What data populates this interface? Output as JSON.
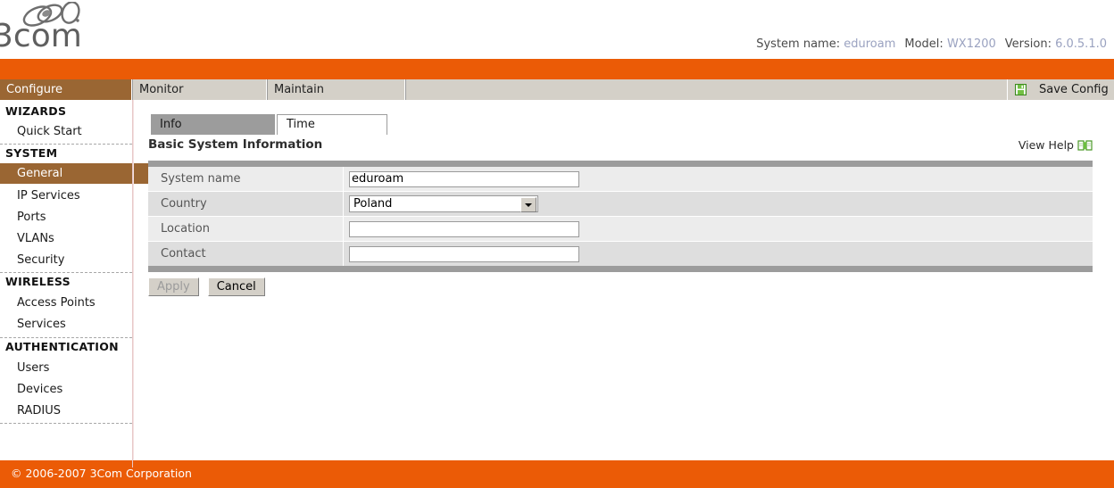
{
  "header": {
    "logo_alt": "3com",
    "system_info": [
      {
        "label": "System name:",
        "value": "eduroam"
      },
      {
        "label": "Model:",
        "value": "WX1200"
      },
      {
        "label": "Version:",
        "value": "6.0.5.1.0"
      }
    ]
  },
  "nav": {
    "tabs": [
      {
        "label": "Configure",
        "active": true
      },
      {
        "label": "Monitor",
        "active": false
      },
      {
        "label": "Maintain",
        "active": false
      }
    ],
    "save_config_label": "Save Config",
    "save_icon": "floppy-disk-icon"
  },
  "sidebar": {
    "groups": [
      {
        "title": "WIZARDS",
        "items": [
          {
            "label": "Quick Start",
            "selected": false
          }
        ]
      },
      {
        "title": "SYSTEM",
        "items": [
          {
            "label": "General",
            "selected": true
          },
          {
            "label": "IP Services",
            "selected": false
          },
          {
            "label": "Ports",
            "selected": false
          },
          {
            "label": "VLANs",
            "selected": false
          },
          {
            "label": "Security",
            "selected": false
          }
        ]
      },
      {
        "title": "WIRELESS",
        "items": [
          {
            "label": "Access Points",
            "selected": false
          },
          {
            "label": "Services",
            "selected": false
          }
        ]
      },
      {
        "title": "AUTHENTICATION",
        "items": [
          {
            "label": "Users",
            "selected": false
          },
          {
            "label": "Devices",
            "selected": false
          },
          {
            "label": "RADIUS",
            "selected": false
          }
        ]
      }
    ]
  },
  "content": {
    "tabs": [
      {
        "label": "Info",
        "active": true
      },
      {
        "label": "Time",
        "active": false
      }
    ],
    "section_title": "Basic System Information",
    "view_help_label": "View Help",
    "view_help_icon": "open-book-icon",
    "form_rows": [
      {
        "label": "System name",
        "type": "text",
        "value": "eduroam",
        "placeholder": ""
      },
      {
        "label": "Country",
        "type": "select",
        "value": "Poland"
      },
      {
        "label": "Location",
        "type": "text",
        "value": "",
        "placeholder": ""
      },
      {
        "label": "Contact",
        "type": "text",
        "value": "",
        "placeholder": ""
      }
    ],
    "buttons": [
      {
        "label": "Apply",
        "disabled": true
      },
      {
        "label": "Cancel",
        "disabled": false
      }
    ]
  },
  "footer": {
    "copyright": "© 2006-2007 3Com Corporation"
  },
  "colors": {
    "orange": "#eb5b06",
    "nav_gray": "#9c9c9c",
    "selected_brown": "#9a6633",
    "value_blue": "#9aa2c0"
  }
}
